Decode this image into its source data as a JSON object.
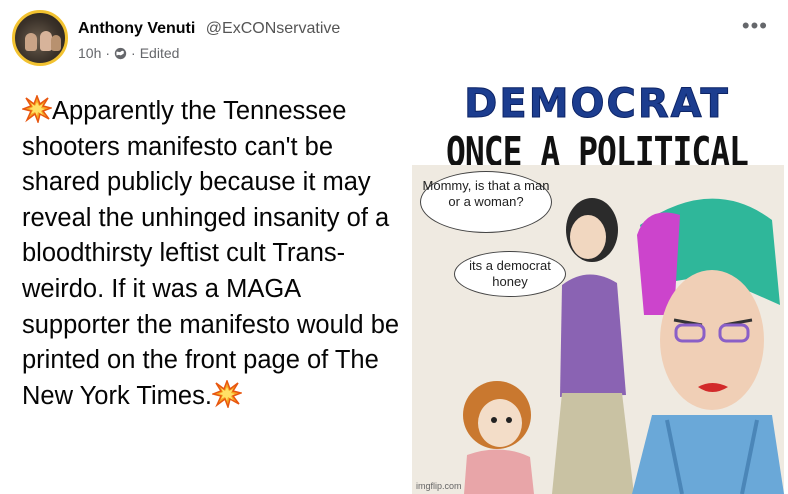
{
  "author": {
    "name": "Anthony Venuti",
    "handle": "@ExCONservative"
  },
  "meta": {
    "time": "10h",
    "separator": "·",
    "visibility_icon": "globe-icon",
    "edited": "Edited"
  },
  "more_icon": "more-options-icon",
  "post": {
    "text": "Apparently the Tennessee shooters manifesto can't be shared publicly because it may reveal the unhinged insanity of a bloodthirsty leftist cult Trans-weirdo. If it was a MAGA supporter the manifesto would be printed on the front page of The New York Times.",
    "lead_emoji": "collision-emoji",
    "trail_emoji": "collision-emoji"
  },
  "meme": {
    "title": "DEMOCRAT",
    "subtitle": "ONCE A POLITICAL PARTY",
    "bubble1": "Mommy, is that a man or a woman?",
    "bubble2": "its a democrat honey",
    "watermark": "imgflip.com"
  },
  "colors": {
    "avatar_ring": "#f2c230",
    "meme_title": "#1c3d8f",
    "text": "#050505",
    "meta": "#65676b"
  }
}
